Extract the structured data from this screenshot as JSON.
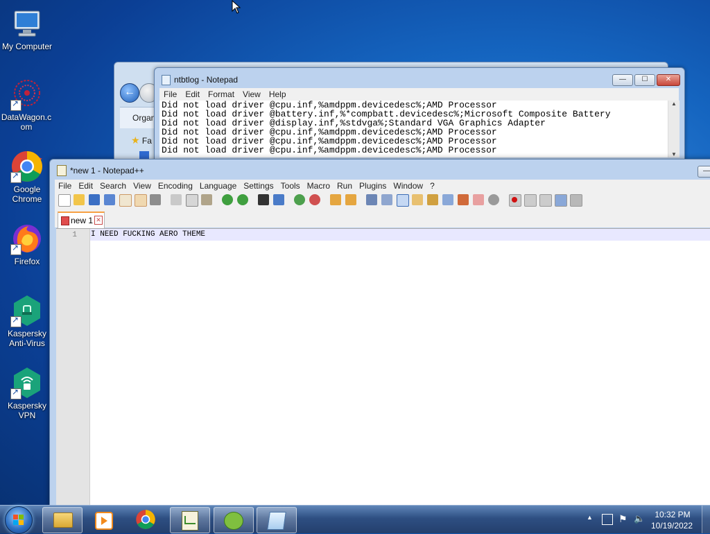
{
  "desktop": {
    "icons": [
      {
        "label": "My Computer"
      },
      {
        "label": "DataWagon.c om"
      },
      {
        "label": "Google Chrome"
      },
      {
        "label": "Firefox"
      },
      {
        "label": "Kaspersky Anti-Virus"
      },
      {
        "label": "Kaspersky VPN"
      }
    ]
  },
  "explorer": {
    "toolbar_text": "Organ",
    "favorites_text": "Fa"
  },
  "notepad": {
    "title": "ntbtlog - Notepad",
    "menu": [
      "File",
      "Edit",
      "Format",
      "View",
      "Help"
    ],
    "lines": [
      "Did not load driver @cpu.inf,%amdppm.devicedesc%;AMD Processor",
      "Did not load driver @battery.inf,%*compbatt.devicedesc%;Microsoft Composite Battery",
      "Did not load driver @display.inf,%stdvga%;Standard VGA Graphics Adapter",
      "Did not load driver @cpu.inf,%amdppm.devicedesc%;AMD Processor",
      "Did not load driver @cpu.inf,%amdppm.devicedesc%;AMD Processor",
      "Did not load driver @cpu.inf,%amdppm.devicedesc%;AMD Processor"
    ],
    "scroll_up": "▲",
    "scroll_down": "▼"
  },
  "notepadpp": {
    "title": "*new 1 - Notepad++",
    "menu": [
      "File",
      "Edit",
      "Search",
      "View",
      "Encoding",
      "Language",
      "Settings",
      "Tools",
      "Macro",
      "Run",
      "Plugins",
      "Window",
      "?"
    ],
    "tab_label": "new 1",
    "tab_close": "✕",
    "line_number": "1",
    "content": "I NEED FUCKING AERO THEME"
  },
  "window_controls": {
    "minimize": "—",
    "maximize": "☐",
    "close": "✕"
  },
  "taskbar": {
    "time": "10:32 PM",
    "date": "10/19/2022",
    "apps": [
      "explorer-icon",
      "media-player-icon",
      "chrome-icon",
      "notepadpp-icon",
      "notepadpp-plugin-icon",
      "notepad-icon"
    ]
  },
  "colors": {
    "accent": "#1565c0",
    "taskbar": "#2e4f82",
    "current_line": "#e8e8ff"
  }
}
